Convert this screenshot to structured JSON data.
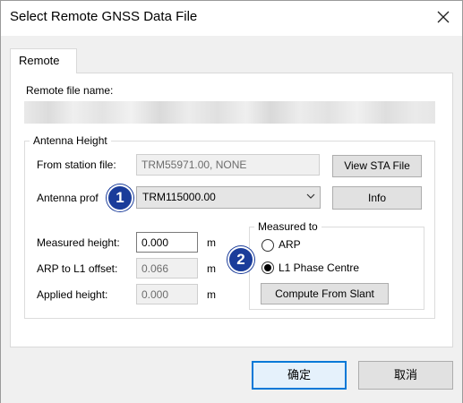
{
  "window": {
    "title": "Select Remote GNSS Data File",
    "close_icon": "close-icon"
  },
  "tabs": [
    {
      "label": "Remote"
    }
  ],
  "remote_file": {
    "label": "Remote file name:"
  },
  "antenna_height": {
    "group_title": "Antenna Height",
    "from_station_label": "From station file:",
    "from_station_value": "TRM55971.00, NONE",
    "view_sta_button": "View STA File",
    "antenna_profile_label": "Antenna prof",
    "antenna_profile_value": "TRM115000.00",
    "info_button": "Info",
    "measured_height_label": "Measured height:",
    "measured_height_value": "0.000",
    "measured_height_unit": "m",
    "arp_l1_label": "ARP to L1 offset:",
    "arp_l1_value": "0.066",
    "arp_l1_unit": "m",
    "applied_height_label": "Applied height:",
    "applied_height_value": "0.000",
    "applied_height_unit": "m"
  },
  "measured_to": {
    "group_title": "Measured to",
    "options": [
      {
        "label": "ARP",
        "selected": false
      },
      {
        "label": "L1 Phase Centre",
        "selected": true
      }
    ],
    "compute_button": "Compute From Slant"
  },
  "annotations": [
    {
      "number": "1",
      "color": "#1a3c9a"
    },
    {
      "number": "2",
      "color": "#1a3c9a"
    }
  ],
  "footer": {
    "ok_button": "确定",
    "cancel_button": "取消"
  }
}
